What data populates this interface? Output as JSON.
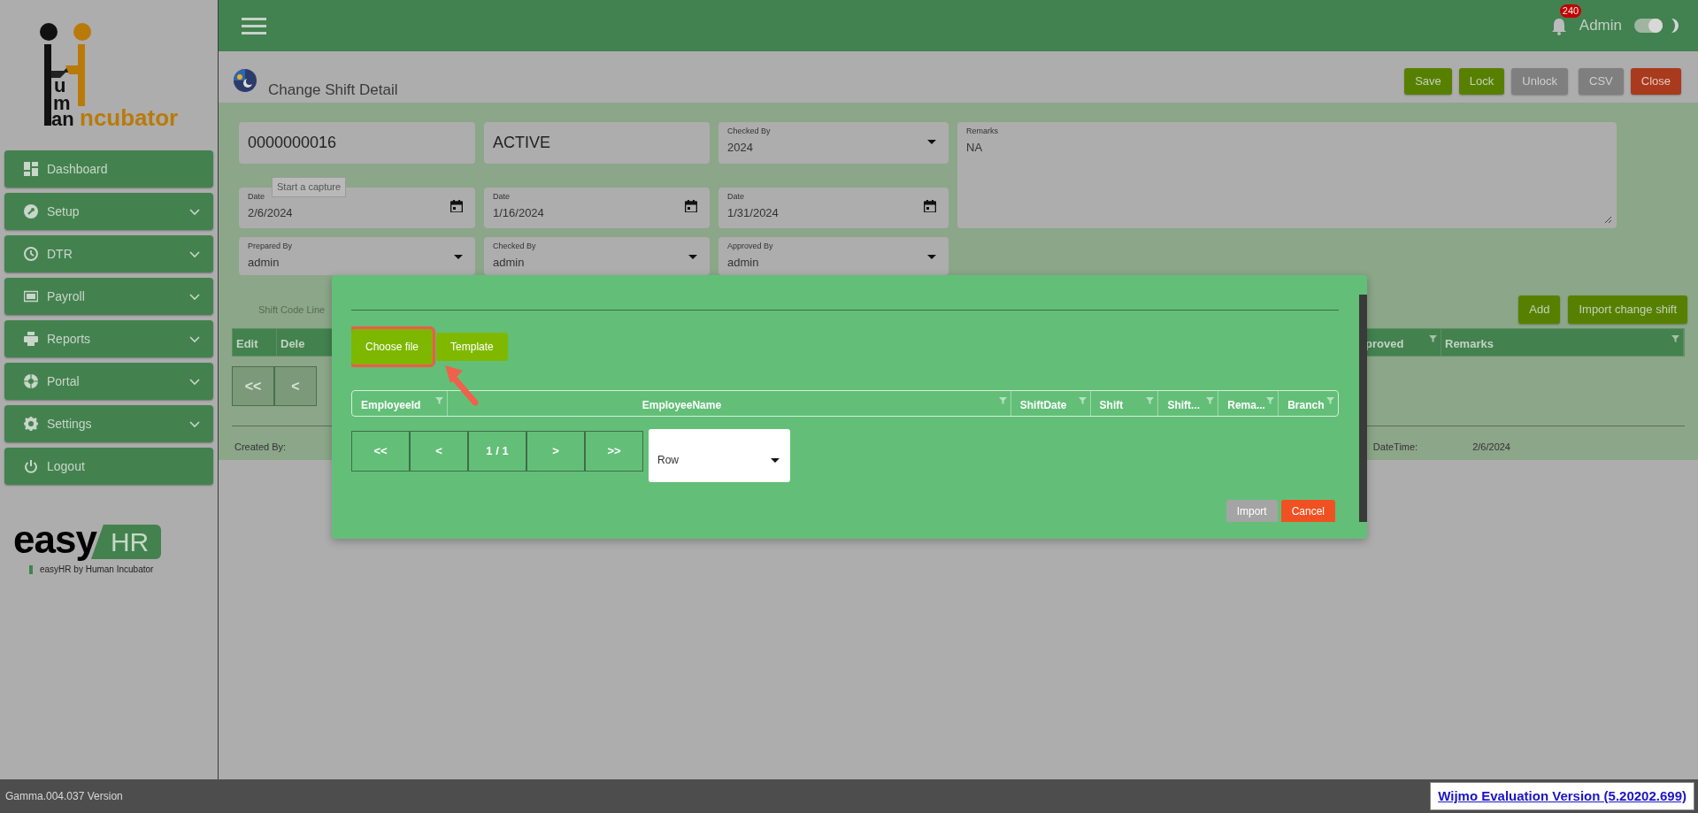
{
  "header": {
    "notifications": "240",
    "user": "Admin",
    "dark_mode": {
      "on": true
    }
  },
  "sidebar": {
    "logo": {
      "letters": [
        "u",
        "m",
        "an",
        "ncubator"
      ]
    },
    "items": [
      {
        "label": "Dashboard",
        "expandable": false
      },
      {
        "label": "Setup",
        "expandable": true
      },
      {
        "label": "DTR",
        "expandable": true
      },
      {
        "label": "Payroll",
        "expandable": true
      },
      {
        "label": "Reports",
        "expandable": true
      },
      {
        "label": "Portal",
        "expandable": true
      },
      {
        "label": "Settings",
        "expandable": true
      },
      {
        "label": "Logout",
        "expandable": false
      }
    ],
    "brand": {
      "word": "easy",
      "badge": "HR",
      "tagline": "easyHR by Human Incubator"
    }
  },
  "page": {
    "title": "Change Shift Detail",
    "toolbar": [
      {
        "label": "Save",
        "kind": "primary",
        "disabled": false
      },
      {
        "label": "Lock",
        "kind": "primary",
        "disabled": false
      },
      {
        "label": "Unlock",
        "kind": "primary",
        "disabled": true
      },
      {
        "label": "CSV",
        "kind": "primary",
        "disabled": true
      },
      {
        "label": "Close",
        "kind": "danger",
        "disabled": false
      }
    ],
    "record": {
      "number": "0000000016",
      "status": "ACTIVE"
    },
    "fields": [
      {
        "kind": "select",
        "label": "Checked By",
        "value": "2024"
      },
      {
        "kind": "date",
        "label": "Date",
        "value": "2/6/2024"
      },
      {
        "kind": "date",
        "label": "Date",
        "value": "1/16/2024"
      },
      {
        "kind": "date",
        "label": "Date",
        "value": "1/31/2024"
      },
      {
        "kind": "select",
        "label": "Prepared By",
        "value": "admin"
      },
      {
        "kind": "select",
        "label": "Checked By",
        "value": "admin"
      },
      {
        "kind": "select",
        "label": "Approved By",
        "value": "admin"
      }
    ],
    "remarks": {
      "label": "Remarks",
      "value": "NA"
    },
    "tooltip": "Start a capture",
    "section_tab": "Shift Code Line",
    "line_buttons": [
      "Add",
      "Import change shift"
    ],
    "table": {
      "left_columns": [
        "Edit",
        "Dele"
      ],
      "right_columns": [
        "proved",
        "Remarks"
      ]
    },
    "pager": [
      "<<",
      "<"
    ],
    "footer": {
      "created_label": "Created By:",
      "datetime_label": "DateTime:",
      "datetime_value": "2/6/2024"
    }
  },
  "modal": {
    "buttons": [
      {
        "label": "Choose file",
        "highlighted": true
      },
      {
        "label": "Template",
        "highlighted": false
      }
    ],
    "columns": [
      "EmployeeId",
      "EmployeeName",
      "ShiftDate",
      "Shift",
      "Shift...",
      "Rema...",
      "Branch"
    ],
    "pager": [
      "<<",
      "<",
      "1 / 1",
      ">",
      ">>"
    ],
    "page_size": {
      "value": "Row"
    },
    "actions": [
      {
        "label": "Import",
        "kind": "primary",
        "disabled": true
      },
      {
        "label": "Cancel",
        "kind": "danger",
        "disabled": false
      }
    ]
  },
  "status_bar": {
    "version": "Gamma.004.037 Version",
    "notice": "Wijmo Evaluation Version (5.20202.699)"
  }
}
